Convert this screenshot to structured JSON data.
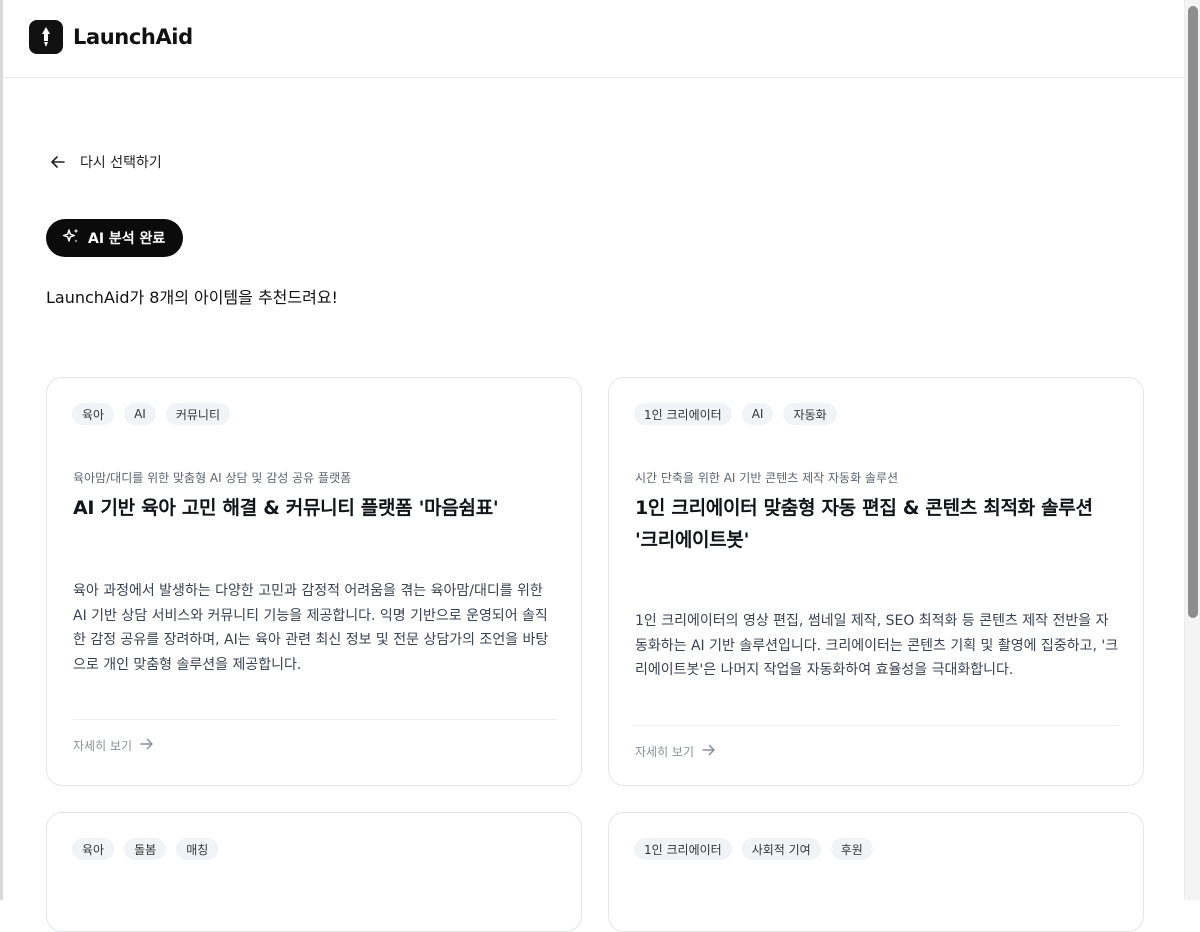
{
  "app": {
    "name": "LaunchAid"
  },
  "nav": {
    "back_label": "다시 선택하기"
  },
  "badge": {
    "label": "AI 분석 완료"
  },
  "summary": "LaunchAid가 8개의 아이템을 추천드려요!",
  "cards": [
    {
      "tags": [
        "육아",
        "AI",
        "커뮤니티"
      ],
      "subtitle": "육아맘/대디를 위한 맞춤형 AI 상담 및 감성 공유 플랫폼",
      "title": "AI 기반 육아 고민 해결 & 커뮤니티 플랫폼 '마음쉼표'",
      "description": "육아 과정에서 발생하는 다양한 고민과 감정적 어려움을 겪는 육아맘/대디를 위한 AI 기반 상담 서비스와 커뮤니티 기능을 제공합니다. 익명 기반으로 운영되어 솔직한 감정 공유를 장려하며, AI는 육아 관련 최신 정보 및 전문 상담가의 조언을 바탕으로 개인 맞춤형 솔루션을 제공합니다.",
      "link": "자세히 보기"
    },
    {
      "tags": [
        "1인 크리에이터",
        "AI",
        "자동화"
      ],
      "subtitle": "시간 단축을 위한 AI 기반 콘텐츠 제작 자동화 솔루션",
      "title": "1인 크리에이터 맞춤형 자동 편집 & 콘텐츠 최적화 솔루션 '크리에이트봇'",
      "description": "1인 크리에이터의 영상 편집, 썸네일 제작, SEO 최적화 등 콘텐츠 제작 전반을 자동화하는 AI 기반 솔루션입니다. 크리에이터는 콘텐츠 기획 및 촬영에 집중하고, '크리에이트봇'은 나머지 작업을 자동화하여 효율성을 극대화합니다.",
      "link": "자세히 보기"
    },
    {
      "tags": [
        "육아",
        "돌봄",
        "매칭"
      ]
    },
    {
      "tags": [
        "1인 크리에이터",
        "사회적 기여",
        "후원"
      ]
    }
  ],
  "icons": {
    "logo": "rocket-icon",
    "back": "arrow-left-icon",
    "badge": "sparkles-icon",
    "link": "arrow-right-icon"
  }
}
